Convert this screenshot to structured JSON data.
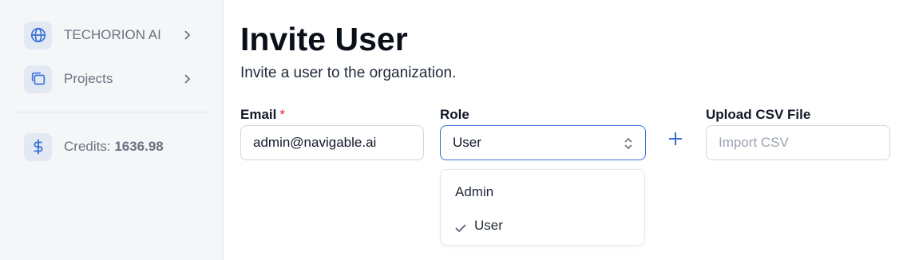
{
  "sidebar": {
    "org": {
      "label": "TECHORION AI",
      "icon": "globe-icon"
    },
    "projects": {
      "label": "Projects",
      "icon": "folders-icon"
    },
    "credits": {
      "label": "Credits:",
      "value": "1636.98",
      "icon": "dollar-icon"
    }
  },
  "page": {
    "title": "Invite User",
    "subtitle": "Invite a user to the organization."
  },
  "form": {
    "email": {
      "label": "Email",
      "required_mark": "*",
      "value": "admin@navigable.ai"
    },
    "role": {
      "label": "Role",
      "selected": "User",
      "options": [
        "Admin",
        "User"
      ]
    },
    "csv": {
      "label": "Upload CSV File",
      "placeholder": "Import CSV"
    },
    "add_icon": "plus-icon"
  },
  "colors": {
    "accent": "#3b6fd6",
    "required": "#dc2626",
    "icon_bg": "#e3e9f3"
  }
}
